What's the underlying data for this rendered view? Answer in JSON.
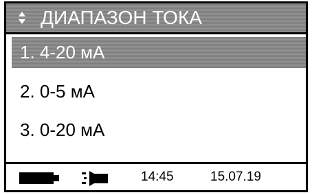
{
  "header": {
    "title": "ДИАПАЗОН ТОКА",
    "nav_icon": "up-down-arrows-icon"
  },
  "menu": {
    "selected_index": 0,
    "items": [
      {
        "label": "1. 4-20 мА"
      },
      {
        "label": "2. 0-5 мА"
      },
      {
        "label": "3. 0-20 мА"
      }
    ]
  },
  "status": {
    "battery_icon": "battery-icon",
    "plug_icon": "power-plug-icon",
    "time": "14:45",
    "date": "15.07.19"
  },
  "colors": {
    "highlight": "#8c8c8c",
    "text": "#000000",
    "background": "#ffffff"
  }
}
